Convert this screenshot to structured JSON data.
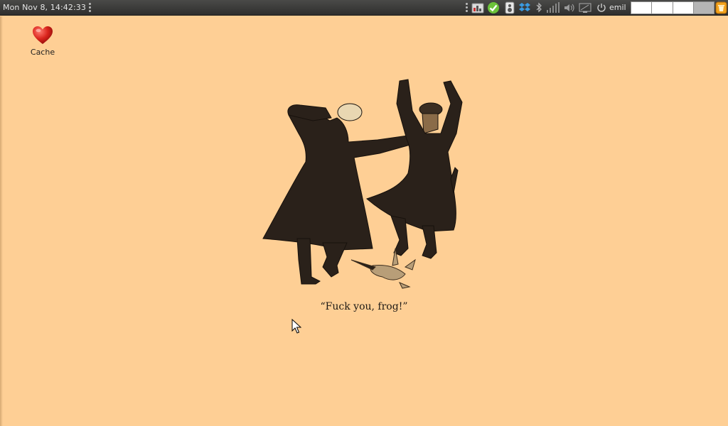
{
  "panel": {
    "clock": "Mon Nov  8, 14:42:33",
    "username": "emil",
    "tray_icons": [
      "network-monitor-icon",
      "update-ok-icon",
      "media-player-icon",
      "dropbox-icon",
      "bluetooth-icon",
      "signal-icon",
      "volume-icon",
      "display-icon",
      "power-icon"
    ],
    "workspaces": [
      "1",
      "2",
      "3",
      "4"
    ],
    "active_workspace": 4
  },
  "desktop": {
    "icons": [
      {
        "label": "Cache",
        "icon": "heart-icon"
      }
    ],
    "wallpaper_caption": "“Fuck you, frog!”"
  },
  "colors": {
    "desktop_background": "#fecf95",
    "panel_background": "#3a3a39",
    "heart": "#d9241c"
  }
}
